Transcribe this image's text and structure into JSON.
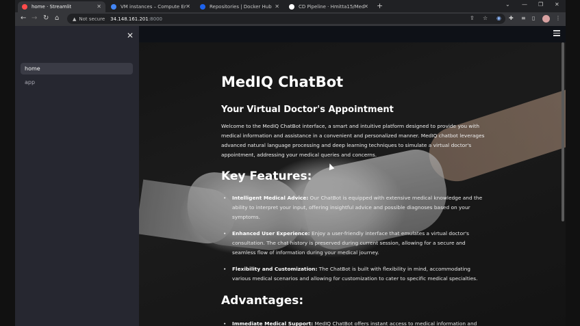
{
  "browser": {
    "tabs": [
      {
        "title": "home · Streamlit",
        "active": true,
        "favicon_color": "#ff4b4b"
      },
      {
        "title": "VM instances – Compute Engine",
        "active": false,
        "favicon_color": "#4285f4"
      },
      {
        "title": "Repositories | Docker Hub",
        "active": false,
        "favicon_color": "#1d63ed"
      },
      {
        "title": "CD Pipeline · Hmitta15/MedIQ-C",
        "active": false,
        "favicon_color": "#ffffff"
      }
    ],
    "new_tab_symbol": "+",
    "address": {
      "security_label": "Not secure",
      "host": "34.148.161.201",
      "port": ":8000"
    }
  },
  "sidebar": {
    "items": [
      {
        "label": "home",
        "active": true
      },
      {
        "label": "app",
        "active": false
      }
    ]
  },
  "main": {
    "title": "MedIQ ChatBot",
    "subtitle": "Your Virtual Doctor's Appointment",
    "intro": "Welcome to the MedIQ ChatBot interface, a smart and intuitive platform designed to provide you with medical information and assistance in a convenient and personalized manner. MedIQ chatbot leverages advanced natural language processing and deep learning techniques to simulate a virtual doctor's appointment, addressing your medical queries and concerns.",
    "features_heading": "Key Features:",
    "features": [
      {
        "label": "Intelligent Medical Advice:",
        "text": " Our ChatBot is equipped with extensive medical knowledge and the ability to interpret your input, offering insightful advice and possible diagnoses based on your symptoms."
      },
      {
        "label": "Enhanced User Experience:",
        "text": " Enjoy a user-friendly interface that emulates a virtual doctor's consultation. The chat history is preserved during current session, allowing for a secure and seamless flow of information during your medical journey."
      },
      {
        "label": "Flexibility and Customization:",
        "text": " The ChatBot is built with flexibility in mind, accommodating various medical scenarios and allowing for customization to cater to specific medical specialties."
      }
    ],
    "advantages_heading": "Advantages:",
    "advantages": [
      {
        "label": "Immediate Medical Support:",
        "text": " MedIQ ChatBot offers instant access to medical information and"
      }
    ]
  },
  "colors": {
    "app_bg": "#0e1117",
    "sidebar_bg": "#262730",
    "browser_tab_bg": "#35363a",
    "streamlit_accent": "#ff4b4b"
  }
}
